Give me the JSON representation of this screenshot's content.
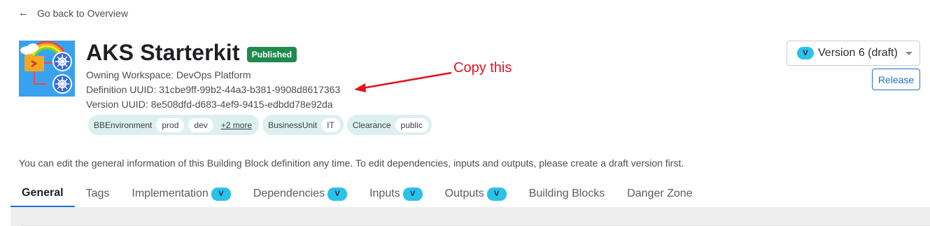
{
  "back_link": {
    "label": "Go back to Overview"
  },
  "header": {
    "title": "AKS Starterkit",
    "status_badge": "Published",
    "owning_workspace": "Owning Workspace: DevOps Platform",
    "definition_uuid": "Definition UUID: 31cbe9ff-99b2-44a3-b381-9908d8617363",
    "version_uuid": "Version UUID: 8e508dfd-d683-4ef9-9415-edbdd78e92da"
  },
  "tags": [
    {
      "key": "BBEnvironment",
      "values": [
        "prod",
        "dev"
      ],
      "more": "+2 more"
    },
    {
      "key": "BusinessUnit",
      "values": [
        "IT"
      ]
    },
    {
      "key": "Clearance",
      "values": [
        "public"
      ]
    }
  ],
  "annotation": {
    "text": "Copy this",
    "color": "#e0141e"
  },
  "version_select": {
    "chip": "V",
    "label": "Version 6 (draft)"
  },
  "release_button": {
    "label": "Release"
  },
  "info_text": "You can edit the general information of this Building Block definition any time. To edit dependencies, inputs and outputs, please create a draft version first.",
  "tabs": [
    {
      "label": "General",
      "chip": ""
    },
    {
      "label": "Tags",
      "chip": ""
    },
    {
      "label": "Implementation",
      "chip": "V"
    },
    {
      "label": "Dependencies",
      "chip": "V"
    },
    {
      "label": "Inputs",
      "chip": "V"
    },
    {
      "label": "Outputs",
      "chip": "V"
    },
    {
      "label": "Building Blocks",
      "chip": ""
    },
    {
      "label": "Danger Zone",
      "chip": ""
    }
  ],
  "colors": {
    "published": "#1f8a4c",
    "accent": "#1e6fd9",
    "chip": "#2ac1ea",
    "tag_bg": "#dcf0f0"
  },
  "icons": {
    "back": "arrow-left-icon",
    "logo": "kubernetes-logo-icon",
    "caret": "caret-down-icon"
  }
}
